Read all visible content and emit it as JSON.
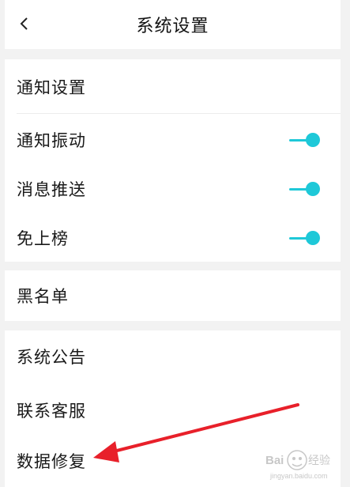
{
  "header": {
    "title": "系统设置",
    "back_icon": "chevron-left-icon"
  },
  "colors": {
    "toggle_on": "#1ec8d8",
    "annotation_arrow": "#e8202a"
  },
  "notifications": {
    "title": "通知设置",
    "items": [
      {
        "label": "通知振动",
        "toggle": true
      },
      {
        "label": "消息推送",
        "toggle": true
      },
      {
        "label": "免上榜",
        "toggle": true
      }
    ]
  },
  "blacklist": {
    "label": "黑名单"
  },
  "system": {
    "items": [
      {
        "label": "系统公告"
      },
      {
        "label": "联系客服"
      },
      {
        "label": "数据修复"
      }
    ]
  },
  "watermark": {
    "text": "Baidu经验",
    "sub": "jingyan.baidu.com"
  }
}
